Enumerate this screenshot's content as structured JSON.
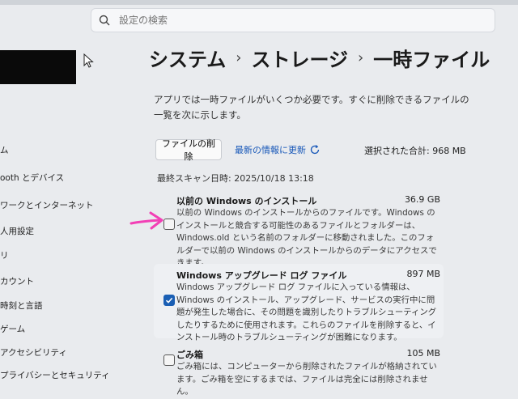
{
  "search": {
    "placeholder": "設定の検索"
  },
  "breadcrumb": {
    "level1": "システム",
    "level2": "ストレージ",
    "level3": "一時ファイル",
    "separator": "›"
  },
  "description": "アプリでは一時ファイルがいくつか必要です。すぐに削除できるファイルの一覧を次に示します。",
  "toolbar": {
    "delete_label": "ファイルの削除",
    "refresh_label": "最新の情報に更新",
    "total_selected": "選択された合計: 968 MB"
  },
  "last_scan": "最終スキャン日時: 2025/10/18 13:18",
  "sidebar": {
    "items": [
      {
        "label": "ム"
      },
      {
        "label": "ooth とデバイス"
      },
      {
        "label": "ワークとインターネット"
      },
      {
        "label": "人用設定"
      },
      {
        "label": "リ"
      },
      {
        "label": "カウント"
      },
      {
        "label": "時刻と言語"
      },
      {
        "label": "ゲーム"
      },
      {
        "label": "アクセシビリティ"
      },
      {
        "label": "プライバシーとセキュリティ"
      }
    ]
  },
  "files": [
    {
      "title": "以前の Windows のインストール",
      "size": "36.9 GB",
      "checked": false,
      "description": "以前の Windows のインストールからのファイルです。Windows のインストールと競合する可能性のあるファイルとフォルダーは、Windows.old という名前のフォルダーに移動されました。このフォルダーで以前の Windows のインストールからのデータにアクセスできます。"
    },
    {
      "title": "Windows アップグレード ログ ファイル",
      "size": "897 MB",
      "checked": true,
      "description": "Windows アップグレード ログ ファイルに入っている情報は、Windows のインストール、アップグレード、サービスの実行中に問題が発生した場合に、その問題を識別したりトラブルシューティングしたりするために使用されます。これらのファイルを削除すると、インストール時のトラブルシューティングが困難になります。"
    },
    {
      "title": "ごみ箱",
      "size": "105 MB",
      "checked": false,
      "description": "ごみ箱には、コンピューターから削除されたファイルが格納されています。ごみ箱を空にするまでは、ファイルは完全には削除されません。"
    }
  ],
  "colors": {
    "accent": "#1a5fb4",
    "link": "#1757b8",
    "annotation": "#f23fb5"
  },
  "icons": {
    "search": "search-icon",
    "refresh": "refresh-icon",
    "cursor": "mouse-pointer-icon",
    "arrow": "arrow-right-icon"
  }
}
